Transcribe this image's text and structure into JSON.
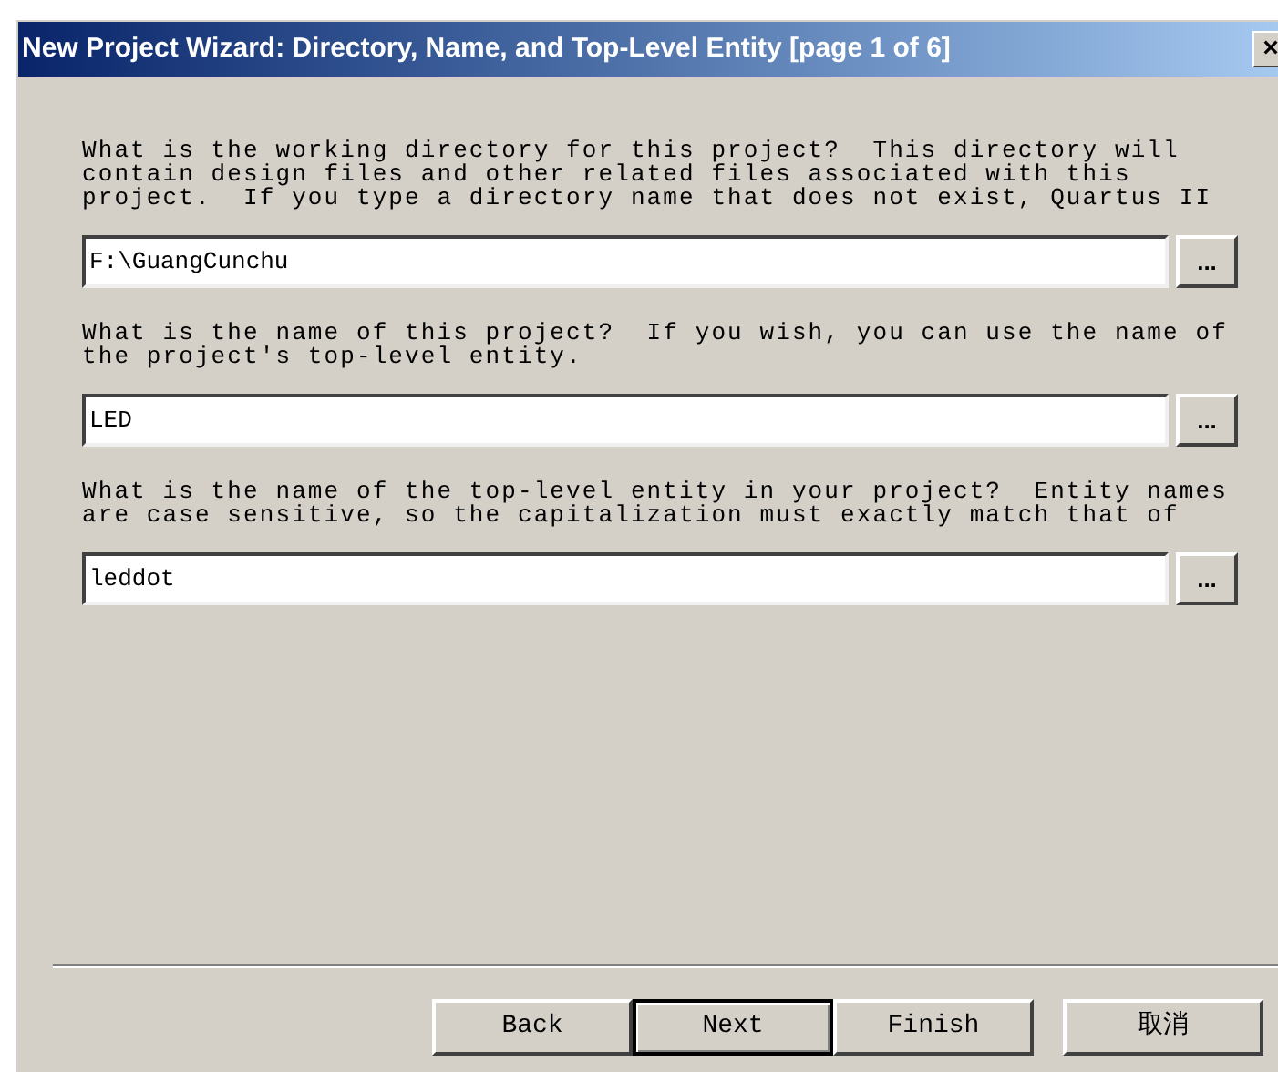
{
  "window": {
    "title": "New Project Wizard: Directory, Name, and Top-Level Entity [page 1 of 6]",
    "close": "×"
  },
  "fields": [
    {
      "label": "What is the working directory for this project?  This directory will\ncontain design files and other related files associated with this\nproject.  If you type a directory name that does not exist, Quartus II",
      "value": "F:\\GuangCunchu",
      "browse": "..."
    },
    {
      "label": "What is the name of this project?  If you wish, you can use the name of\nthe project's top-level entity.",
      "value": "LED",
      "browse": "..."
    },
    {
      "label": "What is the name of the top-level entity in your project?  Entity names\nare case sensitive, so the capitalization must exactly match that of",
      "value": "leddot",
      "browse": "..."
    }
  ],
  "buttons": [
    {
      "label": "Back",
      "default": false
    },
    {
      "label": "Next",
      "default": true
    },
    {
      "label": "Finish",
      "default": false
    },
    {
      "label": "取消",
      "default": false
    }
  ]
}
